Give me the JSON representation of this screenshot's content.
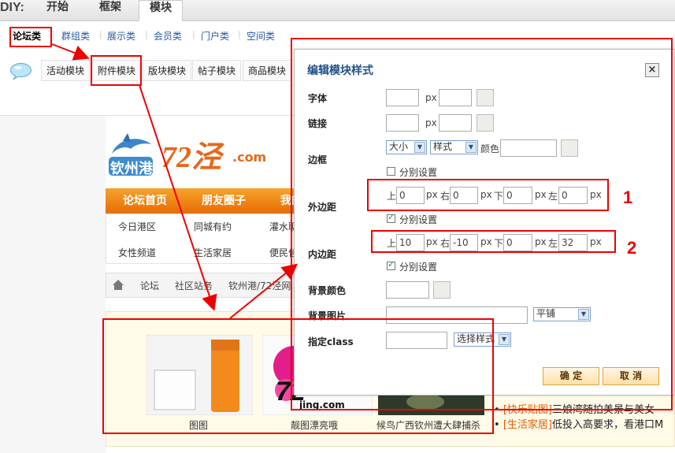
{
  "topbar": {
    "diy_label": "DIY:",
    "tabs": [
      {
        "label": "开始"
      },
      {
        "label": "框架"
      },
      {
        "label": "模块"
      }
    ]
  },
  "subcategories": [
    {
      "label": "论坛类"
    },
    {
      "label": "群组类"
    },
    {
      "label": "展示类"
    },
    {
      "label": "会员类"
    },
    {
      "label": "门户类"
    },
    {
      "label": "空间类"
    }
  ],
  "modules": [
    {
      "label": "活动模块"
    },
    {
      "label": "附件模块"
    },
    {
      "label": "版块模块"
    },
    {
      "label": "帖子模块"
    },
    {
      "label": "商品模块"
    }
  ],
  "site": {
    "logo_text": "钦州港",
    "logo_brand": "72泾",
    "logo_tld": ".com",
    "nav": [
      {
        "label": "论坛首页"
      },
      {
        "label": "朋友圈子"
      },
      {
        "label": "我的"
      }
    ],
    "subnav": [
      {
        "label": "今日港区"
      },
      {
        "label": "同城有约"
      },
      {
        "label": "灌水聊"
      },
      {
        "label": "女性频道"
      },
      {
        "label": "生活家居"
      },
      {
        "label": "便民信"
      }
    ],
    "breadcrumb": [
      {
        "label": "论坛"
      },
      {
        "label": "社区站务"
      },
      {
        "label": "钦州港/72泾网"
      }
    ],
    "gallery": [
      {
        "caption": "图图"
      },
      {
        "caption": "靓图漂亮哦"
      },
      {
        "caption": "候鸟广西钦州遭大肆捕杀"
      }
    ],
    "watermark_brand": "72",
    "watermark_domain": "jing.com",
    "news": [
      {
        "tag": "[快乐贴图]",
        "text": "三娘湾随拍美景与美女"
      },
      {
        "tag": "[生活家居]",
        "text": "低投入高要求，看港口M"
      }
    ]
  },
  "dialog": {
    "title": "编辑模块样式",
    "labels": {
      "font": "字体",
      "link": "链接",
      "border": "边框",
      "margin": "外边距",
      "padding": "内边距",
      "bgcolor": "背景颜色",
      "bgimage": "背景图片",
      "klass": "指定class"
    },
    "unit_px": "px",
    "border": {
      "size_select": "大小",
      "style_select": "样式",
      "color_label": "颜色",
      "separate_label": "分别设置"
    },
    "margin": {
      "top_label": "上",
      "top": "0",
      "right_label": "右",
      "right": "0",
      "bottom_label": "下",
      "bottom": "0",
      "left_label": "左",
      "left": "0",
      "separate_label": "分别设置"
    },
    "padding": {
      "top_label": "上",
      "top": "10",
      "right_label": "右",
      "right": "-10",
      "bottom_label": "下",
      "bottom": "0",
      "left_label": "左",
      "left": "32",
      "separate_label": "分别设置"
    },
    "bg_repeat": "平铺",
    "class_select": "选择样式",
    "confirm": "确 定",
    "cancel": "取 消"
  },
  "annotations": {
    "num1": "1",
    "num2": "2"
  },
  "colors": {
    "annotation_red": "#e00000",
    "nav_orange": "#e86b07",
    "dialog_title": "#1f4f8a",
    "link_blue": "#2a5aa5"
  }
}
